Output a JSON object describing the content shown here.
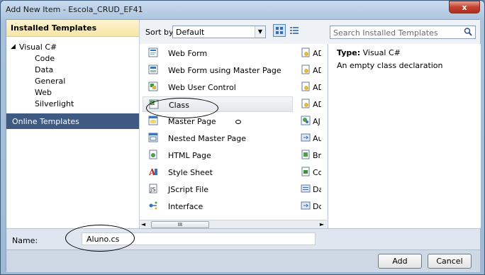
{
  "window": {
    "title": "Add New Item - Escola_CRUD_EF41",
    "close_glyph": "x"
  },
  "left_pane": {
    "installed_header": "Installed Templates",
    "tree": [
      {
        "label": "Visual C#",
        "expander": "◢"
      },
      {
        "label": "Code"
      },
      {
        "label": "Data"
      },
      {
        "label": "General"
      },
      {
        "label": "Web"
      },
      {
        "label": "Silverlight"
      }
    ],
    "online_header": "Online Templates"
  },
  "toolbar": {
    "sort_label": "Sort by:",
    "sort_value": "Default",
    "search_placeholder": "Search Installed Templates"
  },
  "templates": [
    {
      "label": "Web Form",
      "icon": "web-form-icon"
    },
    {
      "label": "Web Form using Master Page",
      "icon": "web-form-master-icon"
    },
    {
      "label": "Web User Control",
      "icon": "user-control-icon"
    },
    {
      "label": "Class",
      "icon": "class-icon",
      "selected": true
    },
    {
      "label": "Master Page",
      "icon": "master-page-icon"
    },
    {
      "label": "Nested Master Page",
      "icon": "nested-master-page-icon"
    },
    {
      "label": "HTML Page",
      "icon": "html-page-icon"
    },
    {
      "label": "Style Sheet",
      "icon": "style-sheet-icon"
    },
    {
      "label": "JScript File",
      "icon": "jscript-file-icon"
    },
    {
      "label": "Interface",
      "icon": "interface-icon"
    }
  ],
  "second_column": [
    "AD",
    "AD",
    "AD",
    "AD",
    "AJ",
    "Au",
    "Br",
    "Co",
    "Da",
    "Do"
  ],
  "scrollbar": {
    "left": "◄",
    "right": "►",
    "grip": "III"
  },
  "details": {
    "type_label": "Type:",
    "type_value": "Visual C#",
    "description": "An empty class declaration"
  },
  "name_field": {
    "label": "Name:",
    "value": "Aluno.cs"
  },
  "buttons": {
    "add": "Add",
    "cancel": "Cancel"
  },
  "colors": {
    "selection": "#3f5a82",
    "installed_header": "#f8e6a6",
    "close": "#c4422f"
  }
}
